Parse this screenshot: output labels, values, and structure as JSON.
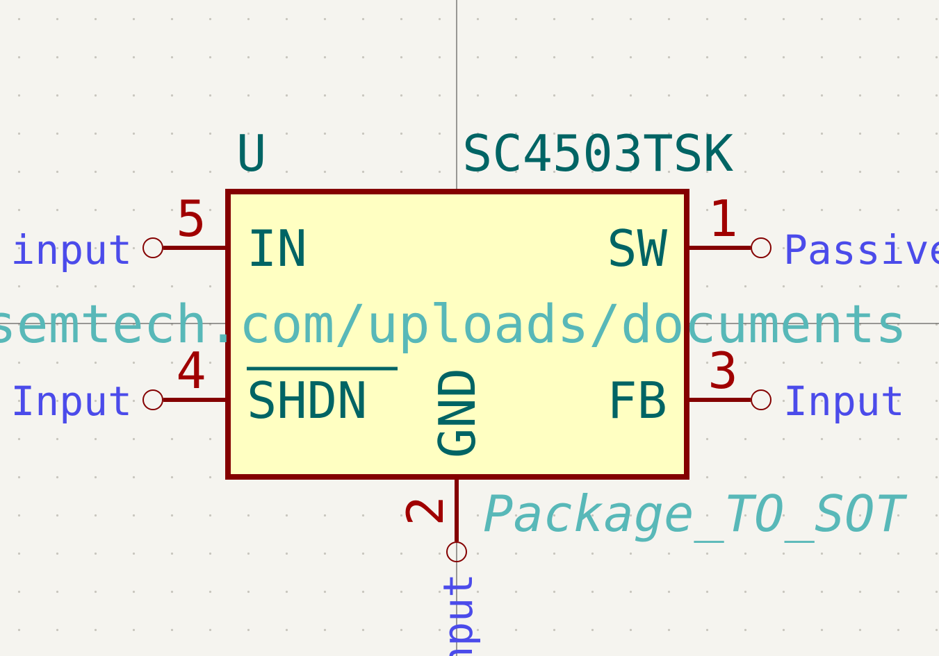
{
  "component": {
    "reference": "U",
    "value": "SC4503TSK",
    "footprint": "Package_TO_SOT",
    "datasheet": "semtech.com/uploads/documents",
    "pins": [
      {
        "number": "5",
        "name": "IN",
        "type": "r input"
      },
      {
        "number": "1",
        "name": "SW",
        "type": "Passive"
      },
      {
        "number": "4",
        "name": "SHDN",
        "type": "Input"
      },
      {
        "number": "3",
        "name": "FB",
        "type": "Input"
      },
      {
        "number": "2",
        "name": "GND",
        "type": "nput"
      }
    ]
  },
  "colors": {
    "background": "#f5f4ef",
    "grid_dot": "#c8c6be",
    "crosshair": "#3a3a3a",
    "body_fill": "#ffffc2",
    "body_outline": "#840000",
    "pin_line": "#840000",
    "pin_number": "#a00000",
    "pin_name": "#006464",
    "pin_type": "#4b4bea",
    "field_text": "#006464",
    "hidden_field": "#58b8b8"
  }
}
